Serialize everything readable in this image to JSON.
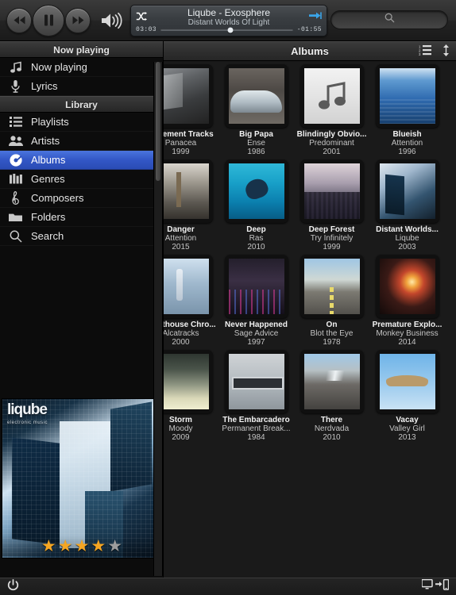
{
  "player": {
    "rewind_label": "Rewind",
    "playpause_label": "Pause",
    "forward_label": "Fast forward",
    "volume_label": "Volume",
    "shuffle_label": "Shuffle",
    "next_label": "Next track",
    "track_title": "Liqube - Exosphere",
    "track_album": "Distant Worlds Of Light",
    "elapsed": "03:03",
    "remaining": "-01:55",
    "progress_percent": 53
  },
  "search": {
    "value": "",
    "placeholder": "",
    "icon": "search-icon"
  },
  "sidebar": {
    "sections": [
      {
        "title": "Now playing",
        "items": [
          {
            "label": "Now playing",
            "icon": "music-note-icon",
            "selected": false
          },
          {
            "label": "Lyrics",
            "icon": "microphone-icon",
            "selected": false
          }
        ]
      },
      {
        "title": "Library",
        "items": [
          {
            "label": "Playlists",
            "icon": "list-icon",
            "selected": false
          },
          {
            "label": "Artists",
            "icon": "people-icon",
            "selected": false
          },
          {
            "label": "Albums",
            "icon": "disc-icon",
            "selected": true
          },
          {
            "label": "Genres",
            "icon": "equalizer-icon",
            "selected": false
          },
          {
            "label": "Composers",
            "icon": "treble-clef-icon",
            "selected": false
          },
          {
            "label": "Folders",
            "icon": "folder-icon",
            "selected": false
          },
          {
            "label": "Search",
            "icon": "search-icon",
            "selected": false
          }
        ]
      }
    ]
  },
  "now_playing_art": {
    "logo": "liqube",
    "logo_sub": "electronic music",
    "rating": 4,
    "rating_max": 5
  },
  "content": {
    "title": "Albums",
    "tools": [
      {
        "name": "sort-numbered-list-icon",
        "label": "Sort order"
      },
      {
        "name": "sort-direction-icon",
        "label": "Sort direction"
      }
    ],
    "albums": [
      {
        "title": "Basement Tracks",
        "artist": "Panacea",
        "year": "1999",
        "art": "cv-basement"
      },
      {
        "title": "Big Papa",
        "artist": "Ense",
        "year": "1986",
        "art": "cv-bigpapa"
      },
      {
        "title": "Blindingly Obvio...",
        "artist": "Predominant",
        "year": "2001",
        "art": "cv-note"
      },
      {
        "title": "Blueish",
        "artist": "Attention",
        "year": "1996",
        "art": "cv-blueish"
      },
      {
        "title": "Danger",
        "artist": "Attention",
        "year": "2015",
        "art": "cv-danger"
      },
      {
        "title": "Deep",
        "artist": "Ras",
        "year": "2010",
        "art": "cv-deep"
      },
      {
        "title": "Deep Forest",
        "artist": "Try Infinitely",
        "year": "1999",
        "art": "cv-forest"
      },
      {
        "title": "Distant Worlds...",
        "artist": "Liqube",
        "year": "2003",
        "art": "cv-distant"
      },
      {
        "title": "Lighthouse Chro...",
        "artist": "Alcatracks",
        "year": "2000",
        "art": "cv-lighthouse"
      },
      {
        "title": "Never Happened",
        "artist": "Sage Advice",
        "year": "1997",
        "art": "cv-never"
      },
      {
        "title": "On",
        "artist": "Blot the Eye",
        "year": "1978",
        "art": "cv-on"
      },
      {
        "title": "Premature Explo...",
        "artist": "Monkey Business",
        "year": "2014",
        "art": "cv-firework"
      },
      {
        "title": "Storm",
        "artist": "Moody",
        "year": "2009",
        "art": "cv-storm"
      },
      {
        "title": "The Embarcadero",
        "artist": "Permanent Break...",
        "year": "1984",
        "art": "cv-embarcadero"
      },
      {
        "title": "There",
        "artist": "Nerdvada",
        "year": "2010",
        "art": "cv-there"
      },
      {
        "title": "Vacay",
        "artist": "Valley Girl",
        "year": "2013",
        "art": "cv-vacay"
      }
    ]
  },
  "bottombar": {
    "power_label": "Power",
    "cast_label": "Connect to device"
  },
  "colors": {
    "accent": "#3357c6",
    "star_on": "#f5a623",
    "star_off": "#9d9d9d",
    "lcd_next": "#3aa4e8"
  }
}
